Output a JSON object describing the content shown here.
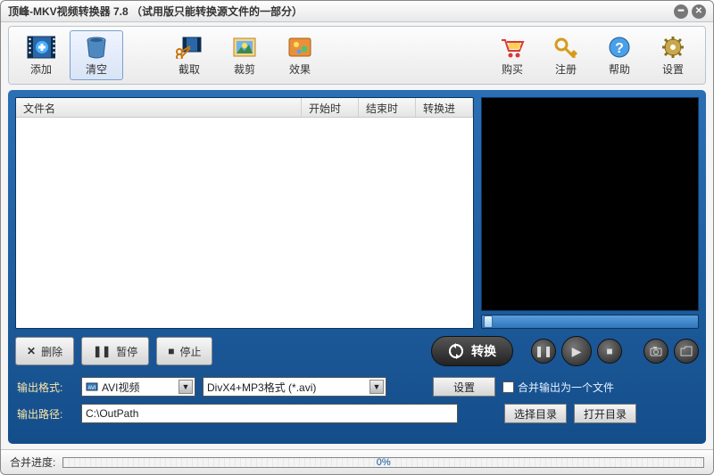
{
  "title": "顶峰-MKV视频转换器 7.8 （试用版只能转换源文件的一部分）",
  "toolbar": {
    "add": "添加",
    "clear": "清空",
    "capture": "截取",
    "crop": "裁剪",
    "effect": "效果",
    "buy": "购买",
    "register": "注册",
    "help": "帮助",
    "settings": "设置"
  },
  "columns": {
    "filename": "文件名",
    "start": "开始时间",
    "end": "结束时间",
    "progress": "转换进度"
  },
  "buttons": {
    "delete": "删除",
    "pause": "暂停",
    "stop": "停止",
    "convert": "转换",
    "settings": "设置",
    "browse": "选择目录",
    "open": "打开目录"
  },
  "output": {
    "format_label": "输出格式:",
    "format_type": "AVI视频",
    "format_codec": "DivX4+MP3格式 (*.avi)",
    "path_label": "输出路径:",
    "path_value": "C:\\OutPath",
    "merge_label": "合并输出为一个文件"
  },
  "status": {
    "label": "合并进度:",
    "percent": "0%"
  }
}
